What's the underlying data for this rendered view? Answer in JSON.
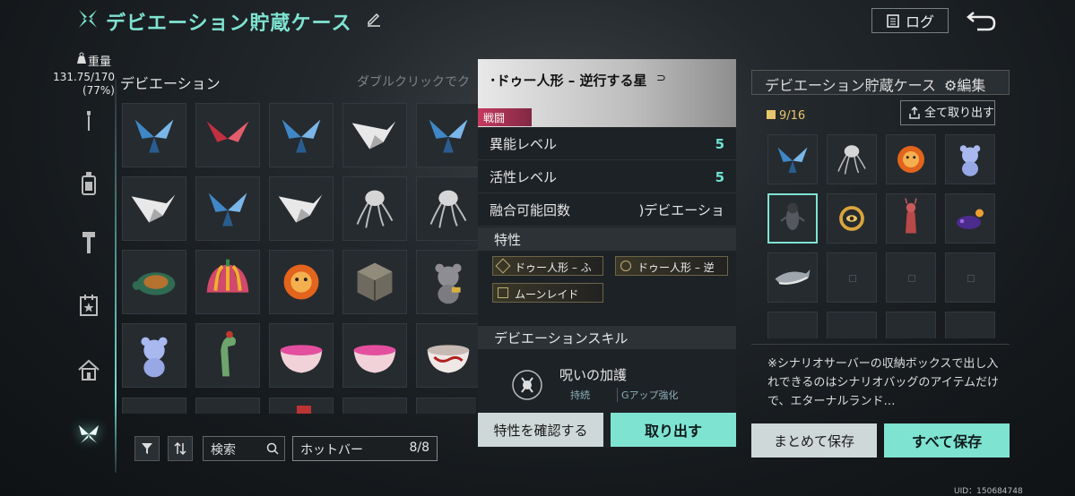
{
  "header": {
    "title": "デビエーション貯蔵ケース",
    "log_label": "ログ"
  },
  "weight": {
    "label": "重量",
    "value": "131.75/170",
    "percent": "(77%)"
  },
  "inventory": {
    "section_title": "デビエーション",
    "hint": "ダブルクリックでク",
    "items": [
      [
        "blue-paper-butterfly",
        "red-paper-butterfly",
        "blue-paper-butterfly",
        "white-paper-crane",
        "blue-paper-butterfly"
      ],
      [
        "white-paper-crane",
        "blue-paper-butterfly",
        "white-paper-crane",
        "jellyfish",
        "jellyfish"
      ],
      [
        "turtle",
        "striped-pumpkin-hat",
        "fire-lion-mask",
        "cube",
        "grey-bear"
      ],
      [
        "blue-bear",
        "green-dinosaur",
        "pink-bowl",
        "pink-bowl",
        "red-bowl"
      ]
    ]
  },
  "toolbar": {
    "search_placeholder": "検索",
    "hotbar_label": "ホットバー",
    "hotbar_count": "8/8"
  },
  "detail": {
    "name": "･ドゥー人形 – 逆行する星",
    "tag": "戦闘",
    "stats": [
      {
        "label": "異能レベル",
        "value": "5"
      },
      {
        "label": "活性レベル",
        "value": "5"
      },
      {
        "label": "融合可能回数",
        "value": ")デビエーショ"
      }
    ],
    "traits_title": "特性",
    "traits": [
      "ドゥー人形 – ふ",
      "ドゥー人形 – 逆",
      "ムーンレイド"
    ],
    "skill_title": "デビエーションスキル",
    "skill_name": "呪いの加護",
    "skill_tags": [
      "持続",
      "Gアップ強化"
    ],
    "check_traits_label": "特性を確認する",
    "take_out_label": "取り出す"
  },
  "storage": {
    "title": "デビエーション貯蔵ケース",
    "edit_label": "編集",
    "count": "9/16",
    "take_all_label": "全て取り出す",
    "items": [
      "blue-paper-butterfly",
      "jellyfish",
      "fire-lion-mask",
      "blue-bear",
      "voodoo-doll",
      "golden-eye-ring",
      "red-figure",
      "purple-creature",
      "shark"
    ],
    "selected_index": 4,
    "note": "※シナリオサーバーの収納ボックスで出し入れできるのはシナリオバッグのアイテムだけで、エターナルランド…",
    "bulk_save_label": "まとめて保存",
    "save_all_label": "すべて保存"
  },
  "uid": "UID：150684748",
  "colors": {
    "accent": "#7fe3d2",
    "combat": "#c53a5e",
    "gold": "#e8c66a"
  }
}
